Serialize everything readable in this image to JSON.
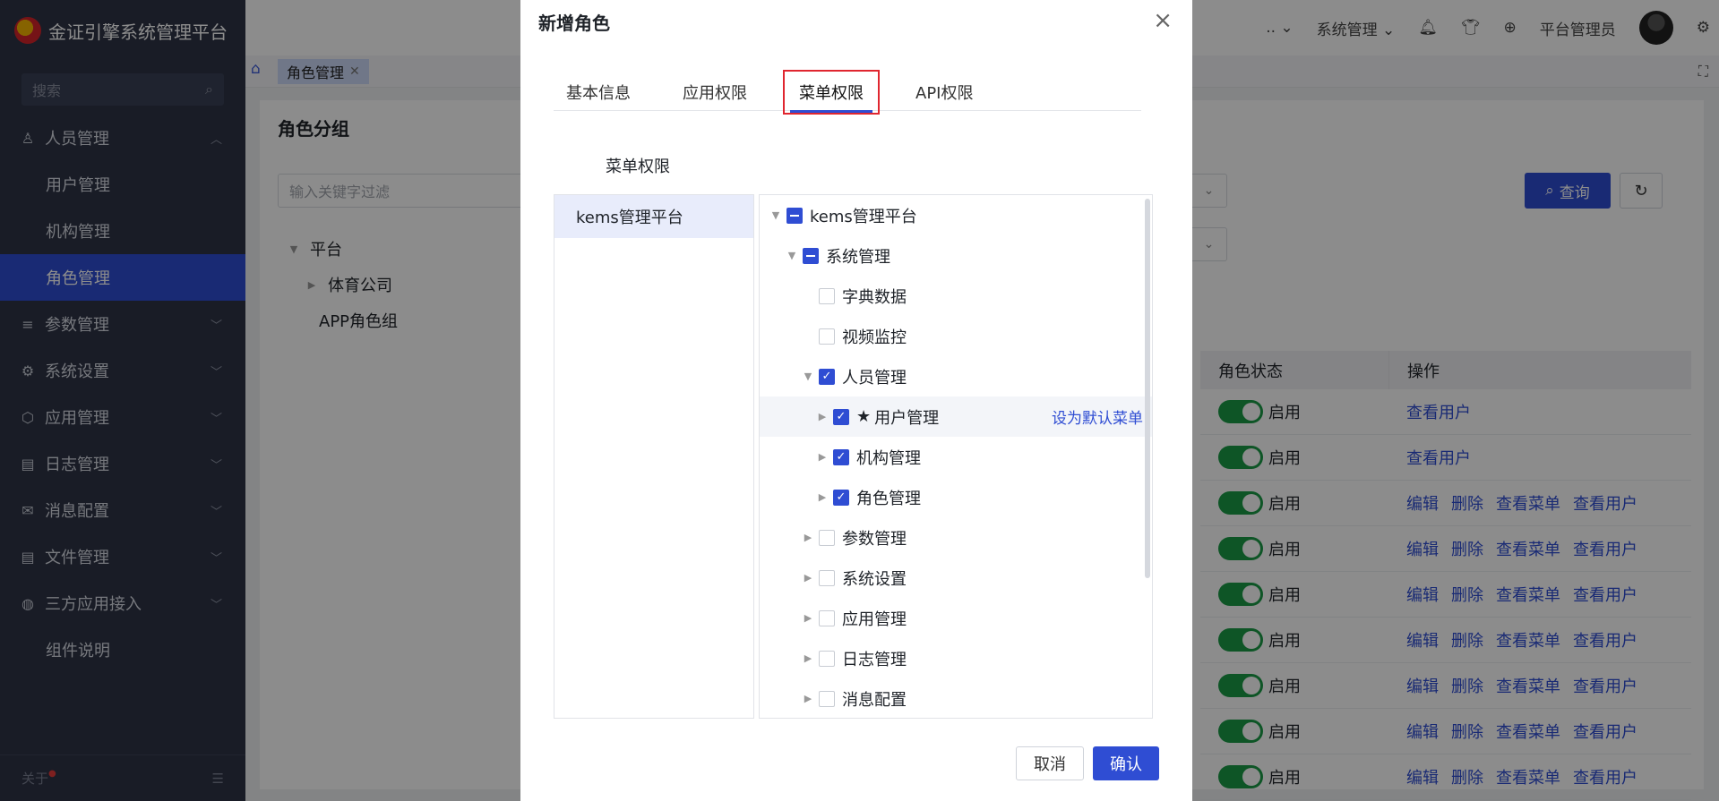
{
  "app": {
    "title": "金证引擎系统管理平台"
  },
  "sidebar": {
    "search_placeholder": "搜索",
    "groups": [
      {
        "label": "人员管理",
        "icon": "user-icon",
        "expanded": true,
        "children": [
          "用户管理",
          "机构管理",
          "角色管理"
        ]
      },
      {
        "label": "参数管理",
        "icon": "sliders-icon"
      },
      {
        "label": "系统设置",
        "icon": "gear-icon"
      },
      {
        "label": "应用管理",
        "icon": "cube-icon"
      },
      {
        "label": "日志管理",
        "icon": "document-icon"
      },
      {
        "label": "消息配置",
        "icon": "message-icon"
      },
      {
        "label": "文件管理",
        "icon": "file-icon"
      },
      {
        "label": "三方应用接入",
        "icon": "globe-icon"
      }
    ],
    "extra_item": "组件说明",
    "active_item": "角色管理",
    "footer_label": "关于"
  },
  "header": {
    "menu_partial": "..",
    "system_menu": "系统管理",
    "user_name": "平台管理员"
  },
  "tabs": {
    "current": "角色管理"
  },
  "page": {
    "panel_title": "角色分组",
    "filter_placeholder": "输入关键字过滤",
    "tree": [
      "平台",
      "体育公司",
      "APP角色组"
    ],
    "query_button": "查询",
    "table": {
      "headers": [
        "角色状态",
        "操作"
      ],
      "status_text": "启用",
      "rows": [
        {
          "actions": [
            "查看用户"
          ]
        },
        {
          "actions": [
            "查看用户"
          ]
        },
        {
          "actions": [
            "编辑",
            "删除",
            "查看菜单",
            "查看用户"
          ]
        },
        {
          "actions": [
            "编辑",
            "删除",
            "查看菜单",
            "查看用户"
          ]
        },
        {
          "actions": [
            "编辑",
            "删除",
            "查看菜单",
            "查看用户"
          ]
        },
        {
          "actions": [
            "编辑",
            "删除",
            "查看菜单",
            "查看用户"
          ]
        },
        {
          "actions": [
            "编辑",
            "删除",
            "查看菜单",
            "查看用户"
          ]
        },
        {
          "actions": [
            "编辑",
            "删除",
            "查看菜单",
            "查看用户"
          ]
        },
        {
          "actions": [
            "编辑",
            "删除",
            "查看菜单",
            "查看用户"
          ]
        }
      ]
    }
  },
  "modal": {
    "title": "新增角色",
    "tabs": [
      "基本信息",
      "应用权限",
      "菜单权限",
      "API权限"
    ],
    "active_tab": "菜单权限",
    "section_label": "菜单权限",
    "apps": [
      "kems管理平台"
    ],
    "tree": [
      {
        "label": "kems管理平台",
        "level": 0,
        "arrow": "expanded",
        "state": "partial"
      },
      {
        "label": "系统管理",
        "level": 1,
        "arrow": "expanded",
        "state": "partial"
      },
      {
        "label": "字典数据",
        "level": 2,
        "arrow": "none",
        "state": "unchecked"
      },
      {
        "label": "视频监控",
        "level": 2,
        "arrow": "none",
        "state": "unchecked"
      },
      {
        "label": "人员管理",
        "level": 2,
        "arrow": "expanded",
        "state": "checked"
      },
      {
        "label": "用户管理",
        "level": 3,
        "arrow": "collapsed",
        "state": "checked",
        "star": true,
        "action": "设为默认菜单"
      },
      {
        "label": "机构管理",
        "level": 3,
        "arrow": "collapsed",
        "state": "checked"
      },
      {
        "label": "角色管理",
        "level": 3,
        "arrow": "collapsed",
        "state": "checked"
      },
      {
        "label": "参数管理",
        "level": 2,
        "arrow": "collapsed",
        "state": "unchecked"
      },
      {
        "label": "系统设置",
        "level": 2,
        "arrow": "collapsed",
        "state": "unchecked"
      },
      {
        "label": "应用管理",
        "level": 2,
        "arrow": "collapsed",
        "state": "unchecked"
      },
      {
        "label": "日志管理",
        "level": 2,
        "arrow": "collapsed",
        "state": "unchecked"
      },
      {
        "label": "消息配置",
        "level": 2,
        "arrow": "collapsed",
        "state": "unchecked"
      }
    ],
    "cancel_label": "取消",
    "confirm_label": "确认"
  },
  "colors": {
    "primary": "#2f4dd3",
    "sidebar_bg": "#2e3346",
    "switch_on": "#1a9b46",
    "highlight_border": "#e0262f"
  }
}
